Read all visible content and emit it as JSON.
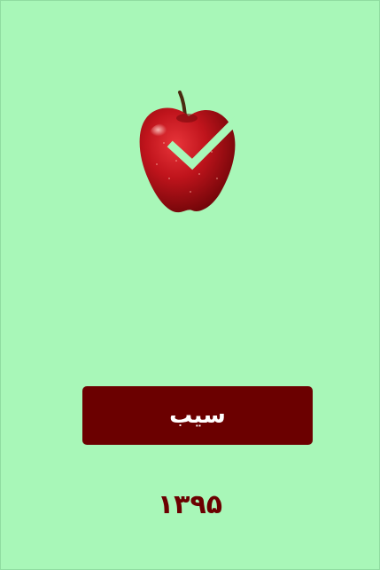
{
  "screen": {
    "background_color": "#a8f7b8",
    "accent_color": "#6b0000"
  },
  "image": {
    "icon": "apple-with-checkmark",
    "apple_color": "#c0141c",
    "check_color": "#a8f7b8"
  },
  "answer_button": {
    "label": "سیب"
  },
  "footer": {
    "year": "۱۳۹۵"
  }
}
